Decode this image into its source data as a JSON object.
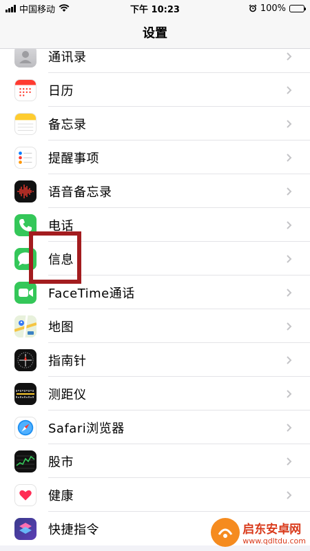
{
  "status_bar": {
    "carrier": "中国移动",
    "time": "下午 10:23",
    "battery": "100%"
  },
  "nav": {
    "title": "设置"
  },
  "items": [
    {
      "label": "通讯录",
      "icon": "contacts-icon"
    },
    {
      "label": "日历",
      "icon": "calendar-icon"
    },
    {
      "label": "备忘录",
      "icon": "notes-icon"
    },
    {
      "label": "提醒事项",
      "icon": "reminders-icon"
    },
    {
      "label": "语音备忘录",
      "icon": "voice-memos-icon"
    },
    {
      "label": "电话",
      "icon": "phone-icon"
    },
    {
      "label": "信息",
      "icon": "messages-icon"
    },
    {
      "label": "FaceTime通话",
      "icon": "facetime-icon"
    },
    {
      "label": "地图",
      "icon": "maps-icon"
    },
    {
      "label": "指南针",
      "icon": "compass-icon"
    },
    {
      "label": "测距仪",
      "icon": "measure-icon"
    },
    {
      "label": "Safari浏览器",
      "icon": "safari-icon"
    },
    {
      "label": "股市",
      "icon": "stocks-icon"
    },
    {
      "label": "健康",
      "icon": "health-icon"
    },
    {
      "label": "快捷指令",
      "icon": "shortcuts-icon"
    }
  ],
  "watermark": {
    "name": "启东安卓网",
    "url": "www.qdltdu.com"
  }
}
